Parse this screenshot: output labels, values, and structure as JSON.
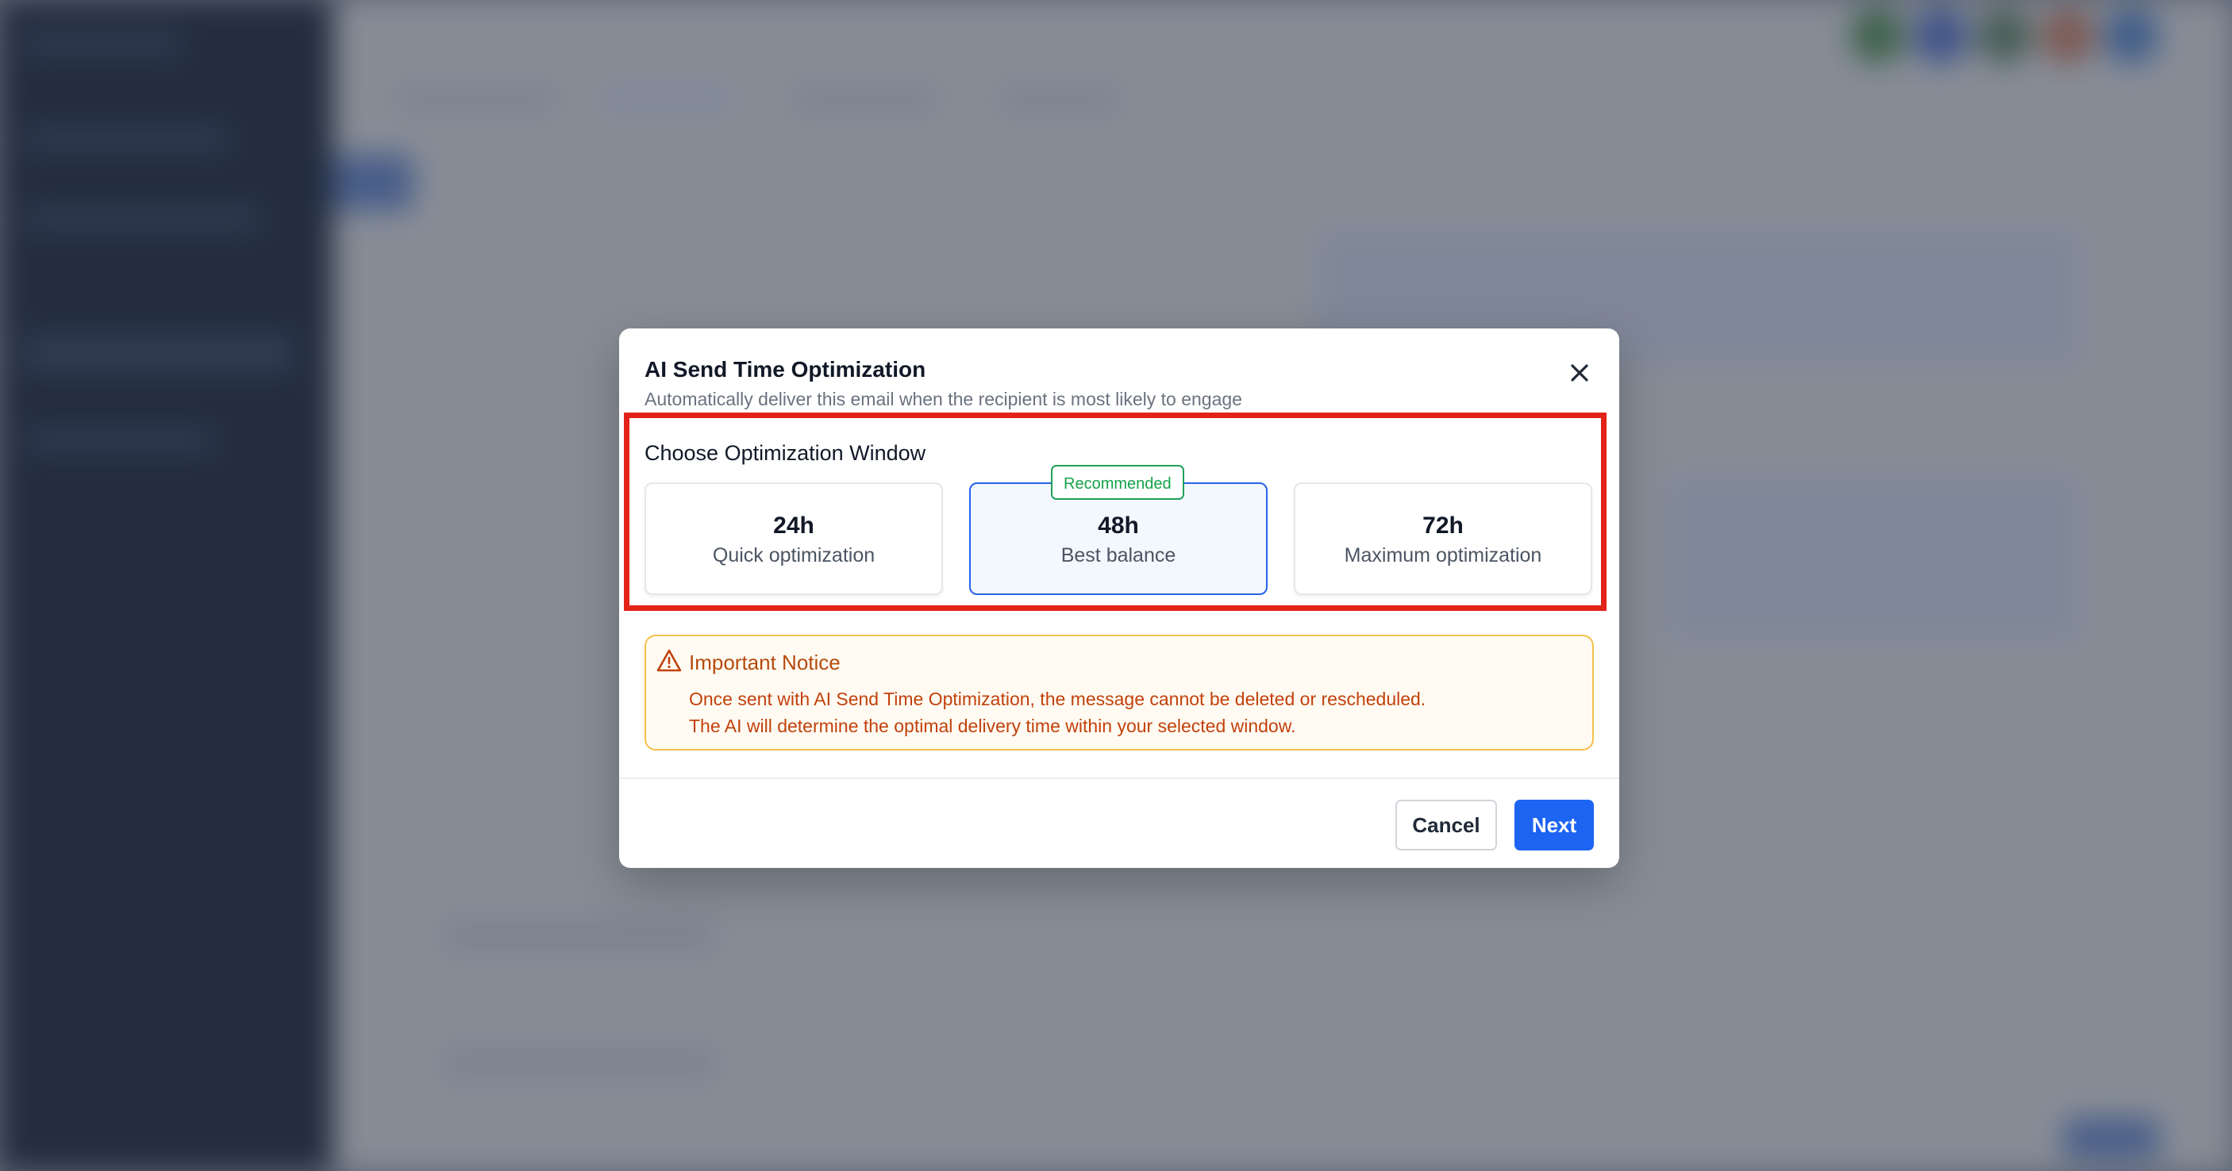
{
  "modal": {
    "title": "AI Send Time Optimization",
    "subtitle": "Automatically deliver this email when the recipient is most likely to engage",
    "section_label": "Choose Optimization Window",
    "options": [
      {
        "hours": "24h",
        "description": "Quick optimization",
        "selected": false
      },
      {
        "hours": "48h",
        "description": "Best balance",
        "selected": true,
        "badge": "Recommended"
      },
      {
        "hours": "72h",
        "description": "Maximum optimization",
        "selected": false
      }
    ],
    "notice": {
      "title": "Important Notice",
      "lines": [
        "Once sent with AI Send Time Optimization, the message cannot be deleted or rescheduled.",
        "The AI will determine the optimal delivery time within your selected window."
      ]
    },
    "buttons": {
      "cancel": "Cancel",
      "next": "Next"
    }
  },
  "colors": {
    "accent": "#1d64f2",
    "selected_border": "#2563eb",
    "badge_green": "#16a34a",
    "notice_text": "#c2410c",
    "notice_border": "#f5c04a",
    "highlight": "#e3231a"
  },
  "icons": {
    "close": "close-icon",
    "warning": "warning-triangle-icon"
  }
}
